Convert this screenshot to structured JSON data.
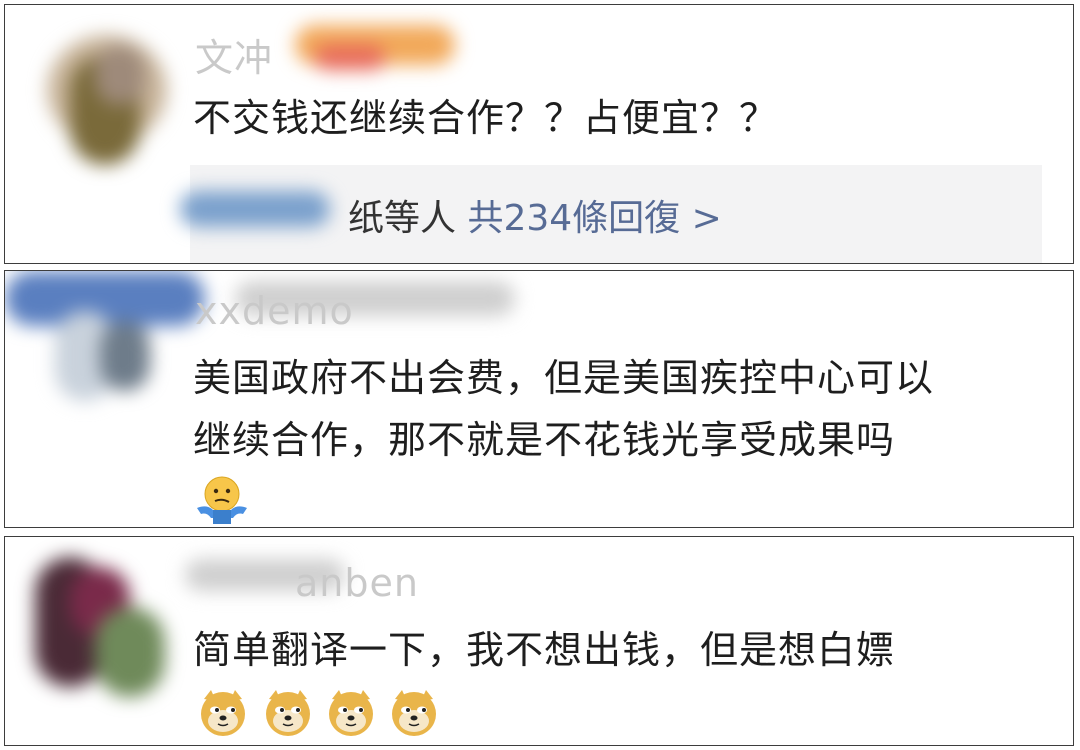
{
  "comments": [
    {
      "username": "文冲",
      "text": "不交钱还继续合作？？占便宜？？",
      "reply_summary": {
        "names_suffix": "纸等人",
        "link_text": "共234條回復 >"
      }
    },
    {
      "username": "xxdemo",
      "text_line1": "美国政府不出会费，但是美国疾控中心可以",
      "text_line2": "继续合作，那不就是不花钱光享受成果吗",
      "emoji": "shrug-emoji"
    },
    {
      "username": "anben",
      "text": "简单翻译一下，我不想出钱，但是想白嫖",
      "emojis": [
        "doge-emoji",
        "doge-emoji",
        "doge-emoji",
        "doge-emoji"
      ]
    }
  ],
  "colors": {
    "card_border": "#3d3d3d",
    "reply_background": "#f3f3f4",
    "link": "#576b95",
    "text": "#1e1e1e",
    "username": "#c9c9c9"
  }
}
